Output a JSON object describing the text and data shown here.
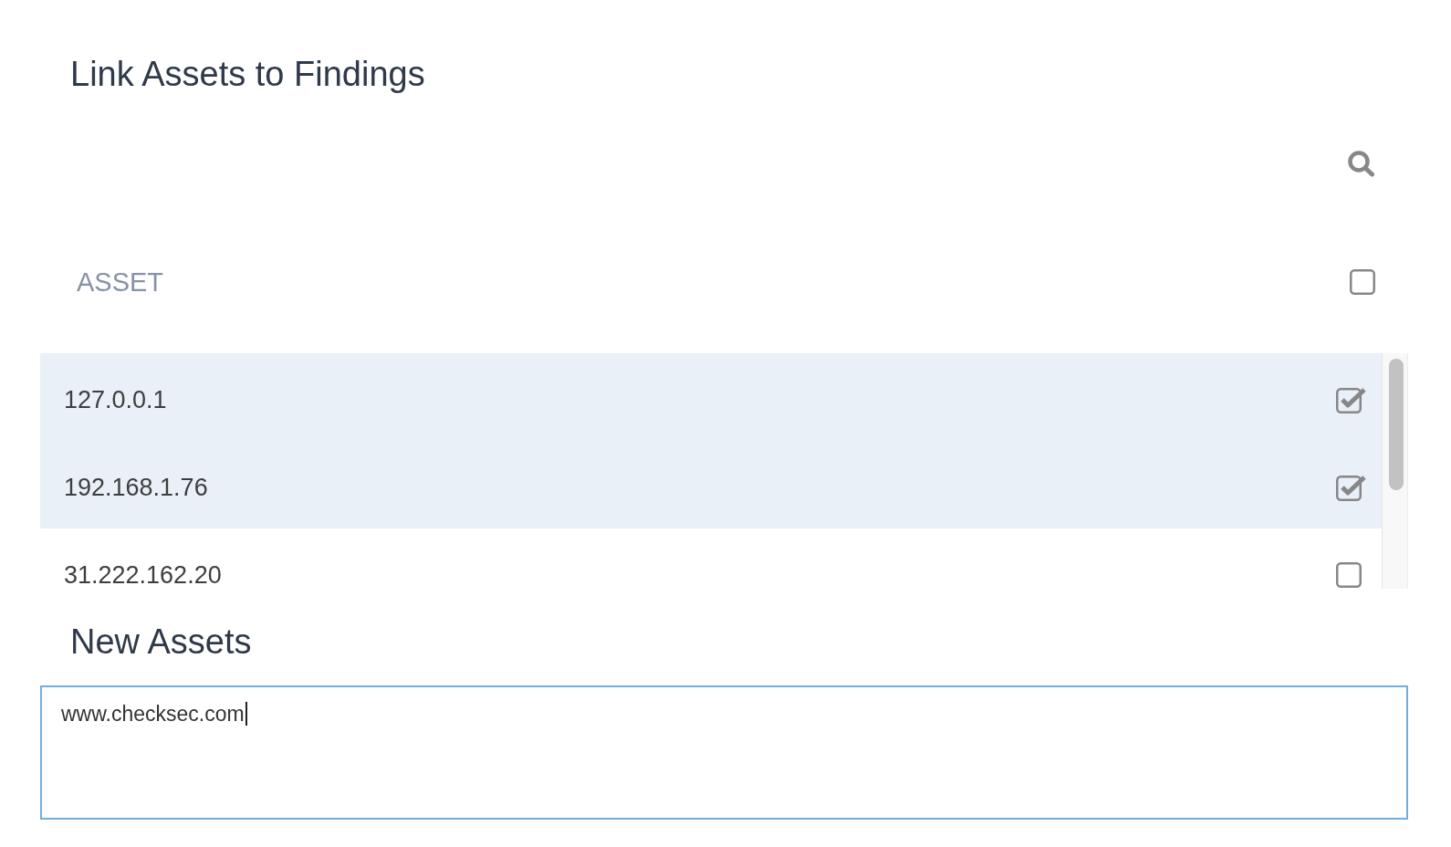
{
  "title": "Link Assets to Findings",
  "table": {
    "header": {
      "label": "ASSET",
      "checked": false
    },
    "rows": [
      {
        "asset": "127.0.0.1",
        "checked": true
      },
      {
        "asset": "192.168.1.76",
        "checked": true
      },
      {
        "asset": "31.222.162.20",
        "checked": false
      }
    ]
  },
  "new_assets": {
    "title": "New Assets",
    "value": "www.checksec.com",
    "focused": true
  }
}
